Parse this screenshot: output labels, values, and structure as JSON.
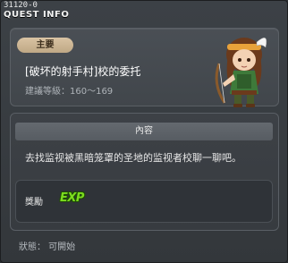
{
  "window": {
    "quest_id": "31120-0",
    "title": "QUEST INFO"
  },
  "quest": {
    "badge": "主要",
    "title": "[破坏的射手村]校的委托",
    "level_range": "建議等級：160～169",
    "portrait_icon": "npc-archer-portrait"
  },
  "content": {
    "header": "內容",
    "description": "去找监视被黑暗笼罩的圣地的监视者校聊一聊吧。"
  },
  "reward": {
    "label": "獎勵",
    "exp_text": "EXP",
    "exp_color": "#7bdc1e"
  },
  "status": {
    "text": "狀態： 可開始"
  }
}
